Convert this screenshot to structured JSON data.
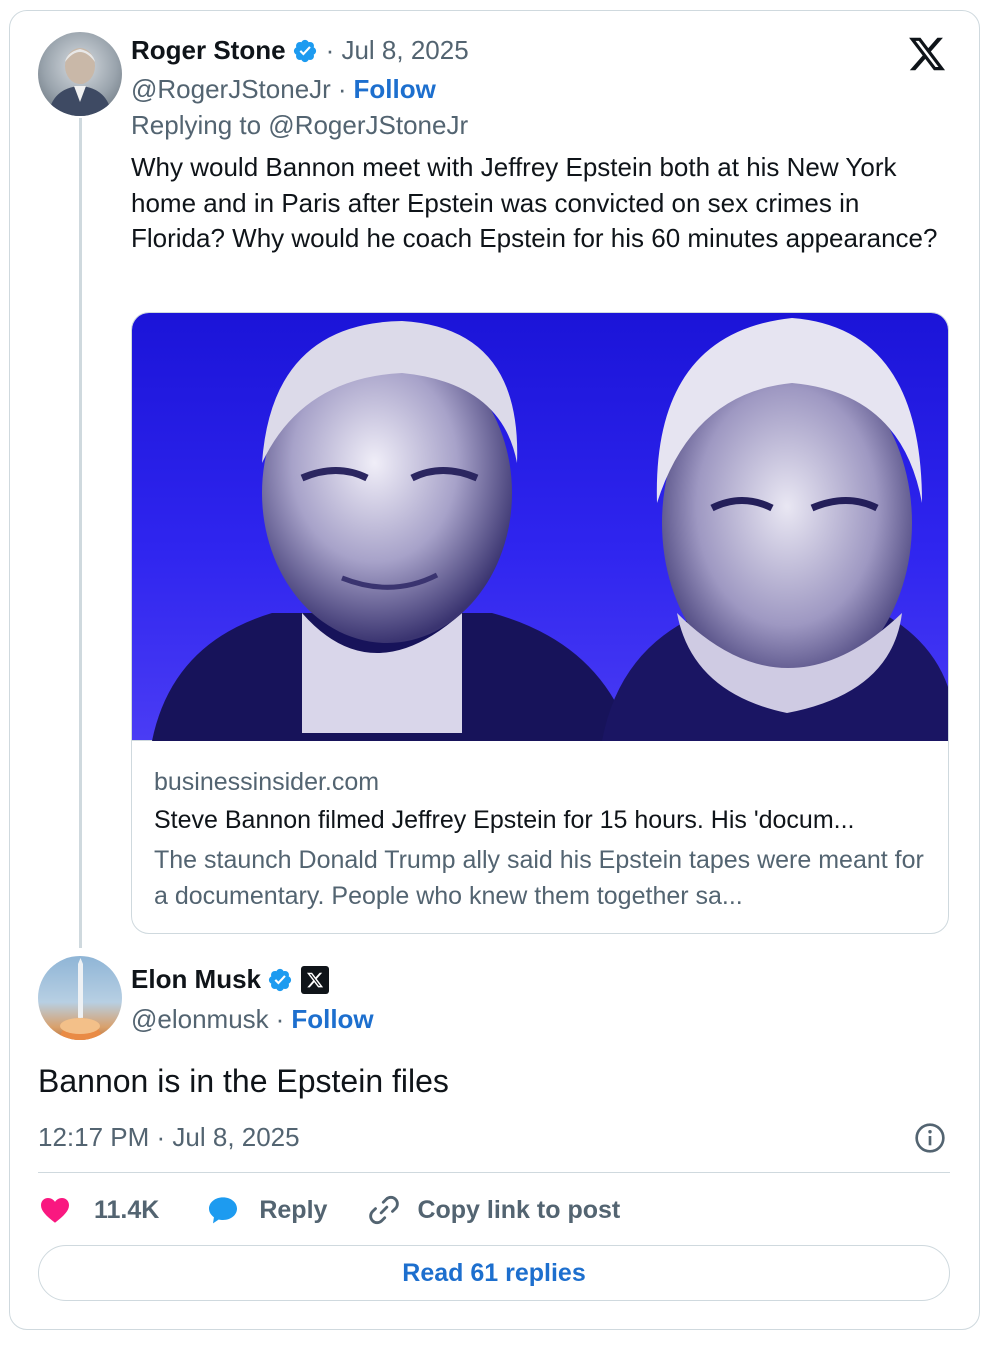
{
  "quoted_tweet": {
    "author_name": "Roger Stone",
    "date": "· Jul 8, 2025",
    "handle": "@RogerJStoneJr",
    "separator": "·",
    "follow_label": "Follow",
    "replying_to": "Replying to @RogerJStoneJr",
    "text": "Why would Bannon meet with Jeffrey Epstein both at his New York home and in Paris after Epstein was convicted on sex crimes in Florida? Why would he coach Epstein for his 60 minutes appearance?",
    "link_card": {
      "domain": "businessinsider.com",
      "title": "Steve Bannon filmed Jeffrey Epstein for 15 hours. His 'docum...",
      "description": "The staunch Donald Trump ally said his Epstein tapes were meant for a documentary. People who knew them together sa..."
    }
  },
  "main_tweet": {
    "author_name": "Elon Musk",
    "handle": "@elonmusk",
    "separator": "·",
    "follow_label": "Follow",
    "text": "Bannon is in the Epstein files",
    "timestamp": "12:17 PM · Jul 8, 2025"
  },
  "actions": {
    "likes_count": "11.4K",
    "reply_label": "Reply",
    "copy_link_label": "Copy link to post"
  },
  "read_replies_label": "Read 61 replies",
  "colors": {
    "link_blue": "#1d6fce",
    "verified_blue": "#1d9bf0",
    "heart_pink": "#f91880",
    "secondary_text": "#536471",
    "border": "#cfd9de"
  },
  "icons": [
    "x-logo-icon",
    "verified-badge-icon",
    "x-affiliate-badge-icon",
    "info-icon",
    "heart-icon",
    "reply-bubble-icon",
    "link-icon"
  ]
}
